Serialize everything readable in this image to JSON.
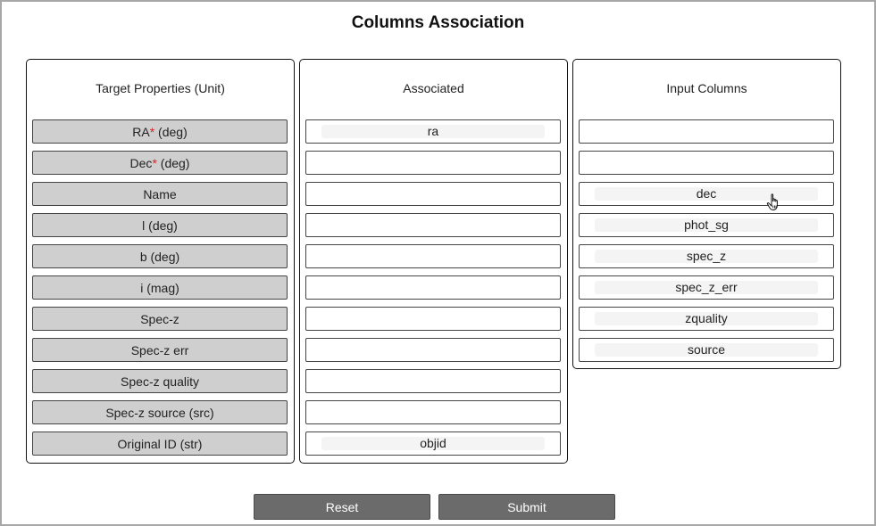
{
  "title": "Columns Association",
  "required_mark": "*",
  "target_panel": {
    "header": "Target Properties (Unit)",
    "items": [
      {
        "label": "RA",
        "required": true,
        "unit": " (deg)"
      },
      {
        "label": "Dec",
        "required": true,
        "unit": " (deg)"
      },
      {
        "label": "Name",
        "required": false,
        "unit": ""
      },
      {
        "label": "l (deg)",
        "required": false,
        "unit": ""
      },
      {
        "label": "b (deg)",
        "required": false,
        "unit": ""
      },
      {
        "label": "i (mag)",
        "required": false,
        "unit": ""
      },
      {
        "label": "Spec-z",
        "required": false,
        "unit": ""
      },
      {
        "label": "Spec-z err",
        "required": false,
        "unit": ""
      },
      {
        "label": "Spec-z quality",
        "required": false,
        "unit": ""
      },
      {
        "label": "Spec-z source (src)",
        "required": false,
        "unit": ""
      },
      {
        "label": "Original ID (str)",
        "required": false,
        "unit": ""
      }
    ]
  },
  "associated_panel": {
    "header": "Associated",
    "slots": [
      "ra",
      "",
      "",
      "",
      "",
      "",
      "",
      "",
      "",
      "",
      "objid"
    ]
  },
  "input_panel": {
    "header": "Input Columns",
    "slots": [
      "",
      "",
      "dec",
      "phot_sg",
      "spec_z",
      "spec_z_err",
      "zquality",
      "source"
    ]
  },
  "buttons": {
    "reset": "Reset",
    "submit": "Submit"
  },
  "colors": {
    "required": "#d4242a",
    "button_bg": "#6b6b6b",
    "target_row_bg": "#cfcfcf"
  }
}
